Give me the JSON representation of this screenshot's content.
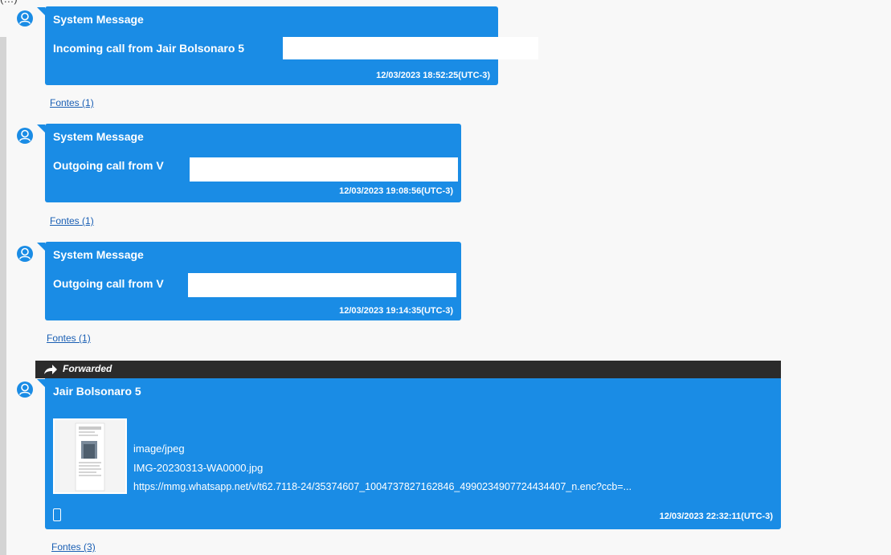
{
  "top_crop_text": "(…)",
  "messages": [
    {
      "sender": "System Message",
      "text": "Incoming call from Jair Bolsonaro 5",
      "timestamp": "12/03/2023 18:52:25(UTC-3)",
      "sources_link": "Fontes (1)"
    },
    {
      "sender": "System Message",
      "text": "Outgoing call from V",
      "timestamp": "12/03/2023 19:08:56(UTC-3)",
      "sources_link": "Fontes (1)"
    },
    {
      "sender": "System Message",
      "text": "Outgoing call from V",
      "timestamp": "12/03/2023 19:14:35(UTC-3)",
      "sources_link": "Fontes (1)"
    }
  ],
  "forwarded_message": {
    "forwarded_label": "Forwarded",
    "sender": "Jair Bolsonaro 5",
    "attachment": {
      "mime_type": "image/jpeg",
      "file_name": "IMG-20230313-WA0000.jpg",
      "url": "https://mmg.whatsapp.net/v/t62.7118-24/35374607_1004737827162846_4990234907724434407_n.enc?ccb=..."
    },
    "timestamp": "12/03/2023 22:32:11(UTC-3)",
    "sources_link": "Fontes (3)"
  },
  "colors": {
    "bubble": "#1a8ce5",
    "forwarded_bar": "#2b2b2b",
    "link": "#1a5fb4",
    "background": "#f8f8f8"
  },
  "icons": {
    "avatar": "user-avatar-icon",
    "forward": "forward-arrow-icon",
    "device": "phone-device-icon"
  }
}
